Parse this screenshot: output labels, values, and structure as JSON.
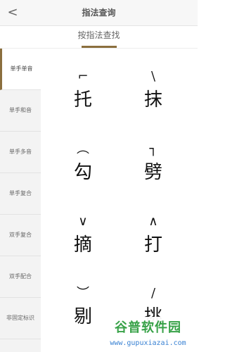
{
  "header": {
    "back_icon": "chevron-left-icon",
    "back_glyph": "<",
    "title": "指法查询"
  },
  "tabs": [
    {
      "label": "按指法查找"
    }
  ],
  "sidebar": {
    "items": [
      {
        "label": "单手单音"
      },
      {
        "label": "单手和音"
      },
      {
        "label": "单手多音"
      },
      {
        "label": "单手复合"
      },
      {
        "label": "双手复合"
      },
      {
        "label": "双手配合"
      },
      {
        "label": "非固定标识"
      }
    ]
  },
  "fingerings": [
    {
      "symbol": "⌐",
      "char": "托"
    },
    {
      "symbol": "\\",
      "char": "抹"
    },
    {
      "symbol": "︵",
      "char": "勾"
    },
    {
      "symbol": "┐",
      "char": "劈"
    },
    {
      "symbol": "∨",
      "char": "摘"
    },
    {
      "symbol": "∧",
      "char": "打"
    },
    {
      "symbol": "︶",
      "char": "剔"
    },
    {
      "symbol": "/",
      "char": "挑"
    }
  ],
  "watermark": {
    "brand": "谷普软件园",
    "url": "www.gupuxiazai.com"
  },
  "colors": {
    "accent": "#8b6f3e",
    "watermark_green": "#2e9e3f",
    "watermark_blue": "#2e7bd1"
  }
}
